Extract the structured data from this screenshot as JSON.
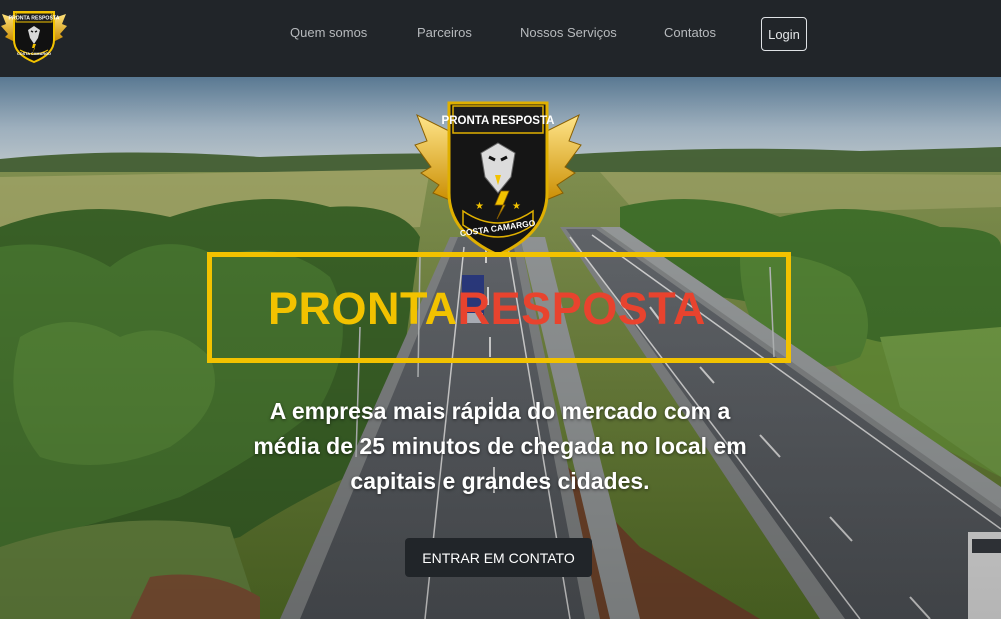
{
  "brand": {
    "logo_top_text": "PRONTA RESPOSTA",
    "logo_bottom_text": "COSTA CAMARGO",
    "icon": "eagle-badge-icon"
  },
  "nav": {
    "items": [
      {
        "label": "Quem somos"
      },
      {
        "label": "Parceiros"
      },
      {
        "label": "Nossos Serviços"
      },
      {
        "label": "Contatos"
      }
    ],
    "login_label": "Login"
  },
  "hero": {
    "emblem": {
      "top_text": "PRONTA RESPOSTA",
      "bottom_text": "COSTA CAMARGO",
      "icon": "eagle-badge-icon"
    },
    "title_part1": "PRONTA",
    "title_part2": "RESPOSTA",
    "tagline": "A empresa mais rápida do mercado com a média de 25 minutos de chegada no local em capitais e grandes cidades.",
    "cta_label": "ENTRAR EM CONTATO",
    "background": "highway-aerial-photo"
  },
  "colors": {
    "navbar_bg": "#212529",
    "gold": "#f2c200",
    "red": "#e8432e",
    "button_bg": "#212529"
  }
}
